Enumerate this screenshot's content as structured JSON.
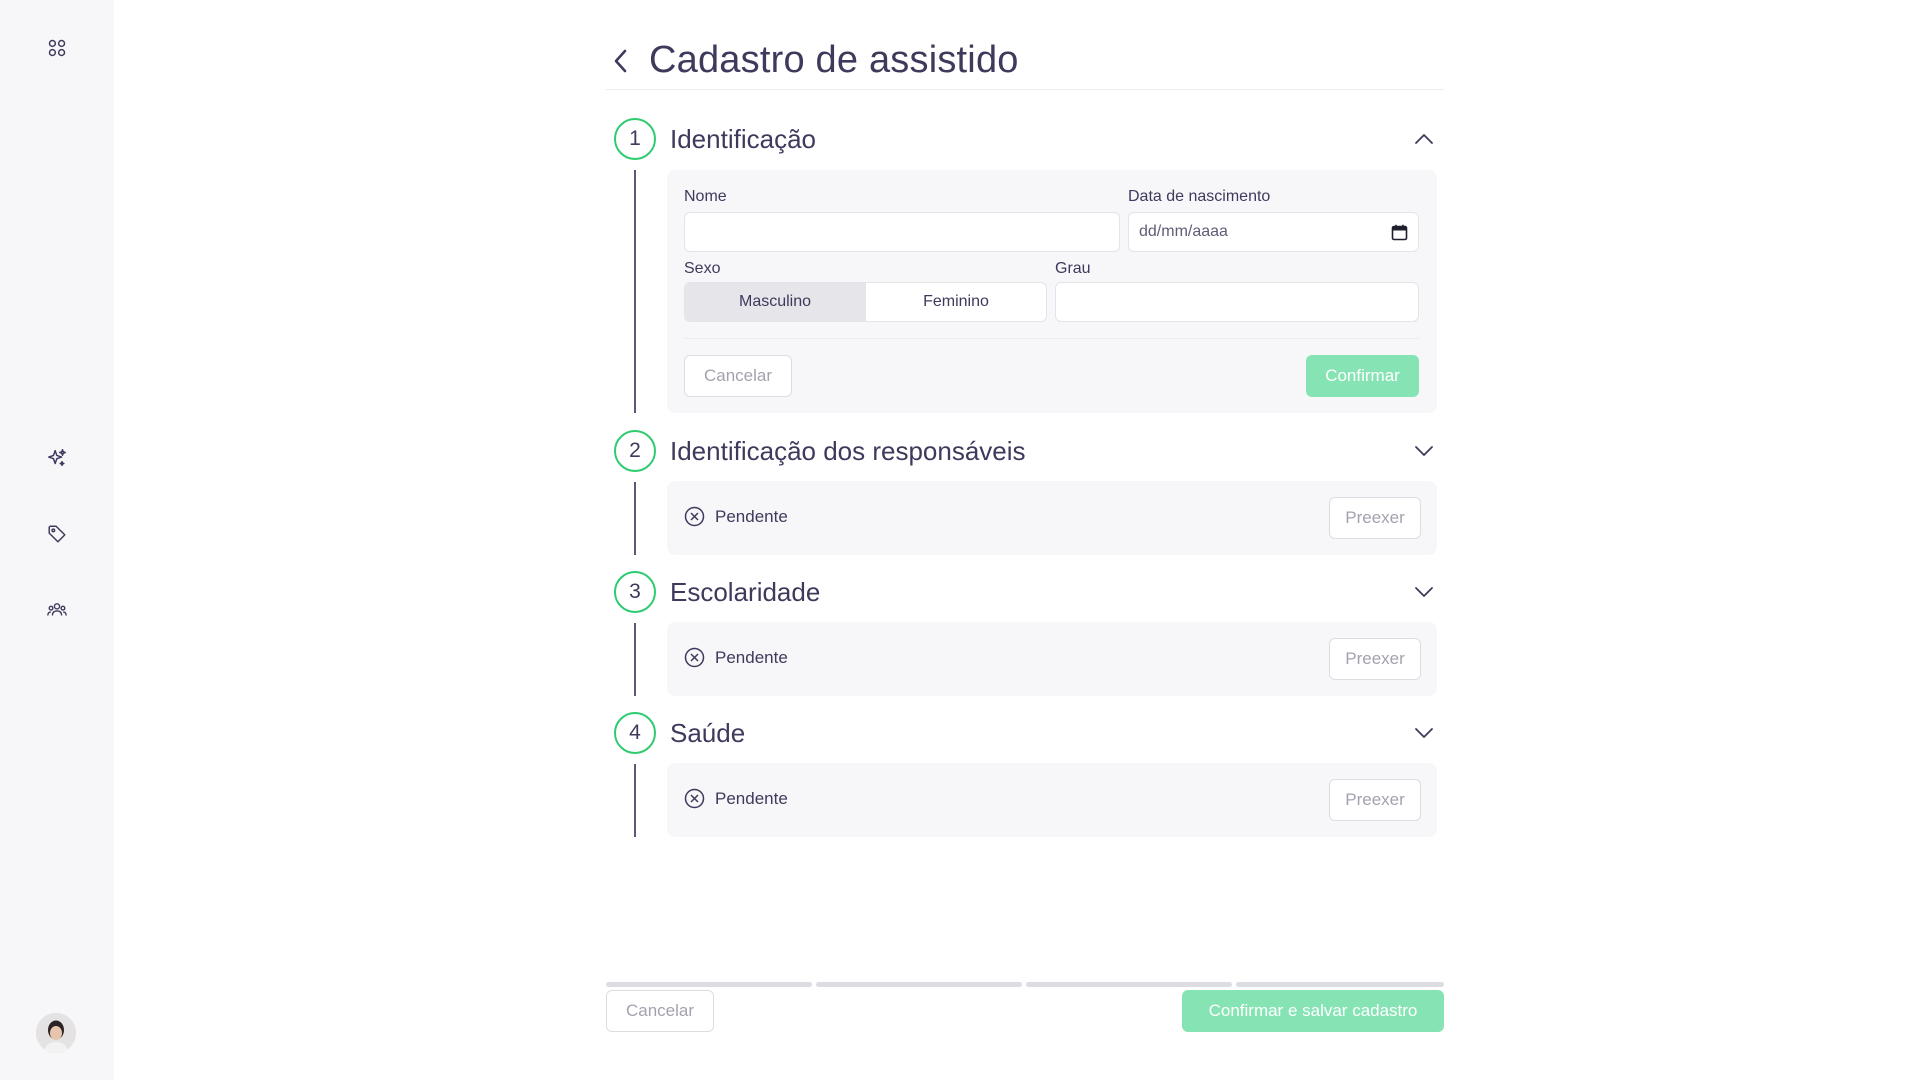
{
  "page": {
    "title": "Cadastro de assistido"
  },
  "icons": {
    "back": "chevron-left-icon",
    "sidebar": [
      "apps-grid-icon",
      "sparkles-icon",
      "tag-icon",
      "users-icon"
    ]
  },
  "colors": {
    "accent_green": "#2ecc71",
    "button_green": "#86e4b4",
    "title_text": "#3d3a5c",
    "sidebar_bg": "#f7f7f9"
  },
  "steps": [
    {
      "number": "1",
      "title": "Identificação",
      "expanded": true,
      "form": {
        "nome_label": "Nome",
        "nome_value": "",
        "nascimento_label": "Data de nascimento",
        "nascimento_placeholder": "dd/mm/aaaa",
        "sexo_label": "Sexo",
        "sexo_options": [
          "Masculino",
          "Feminino"
        ],
        "sexo_selected": "Masculino",
        "grau_label": "Grau",
        "grau_value": "",
        "cancel_label": "Cancelar",
        "confirm_label": "Confirmar"
      }
    },
    {
      "number": "2",
      "title": "Identificação dos responsáveis",
      "expanded": false,
      "status": "Pendente",
      "action_label": "Preexer"
    },
    {
      "number": "3",
      "title": "Escolaridade",
      "expanded": false,
      "status": "Pendente",
      "action_label": "Preexer"
    },
    {
      "number": "4",
      "title": "Saúde",
      "expanded": false,
      "status": "Pendente",
      "action_label": "Preexer"
    }
  ],
  "progress": {
    "segments": 4,
    "completed": 0
  },
  "footer": {
    "cancel_label": "Cancelar",
    "submit_label": "Confirmar e salvar cadastro"
  }
}
